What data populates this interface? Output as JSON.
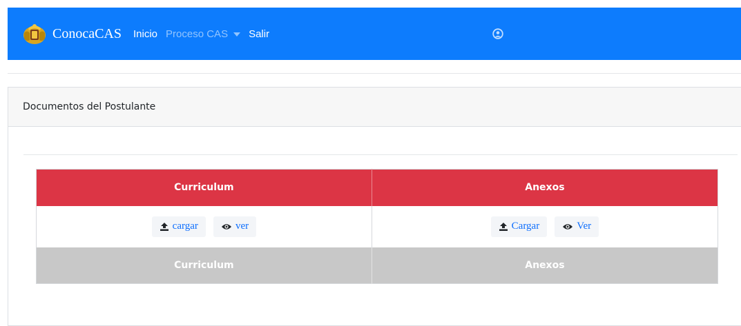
{
  "navbar": {
    "brand": "ConocaCAS",
    "items": [
      {
        "label": "Inicio"
      },
      {
        "label": "Proceso CAS"
      },
      {
        "label": "Salir"
      }
    ],
    "bg_color": "#0d7cfd",
    "user_icon": "user-circle-icon"
  },
  "card": {
    "header": "Documentos del Postulante"
  },
  "table": {
    "headers": [
      "Curriculum",
      "Anexos"
    ],
    "row": {
      "curriculum": {
        "upload_label": "cargar",
        "view_label": "ver"
      },
      "anexos": {
        "upload_label": "Cargar",
        "view_label": "Ver"
      }
    },
    "footer": [
      "Curriculum",
      "Anexos"
    ],
    "header_color": "#dc3545",
    "footer_color": "#c8c8c8"
  }
}
